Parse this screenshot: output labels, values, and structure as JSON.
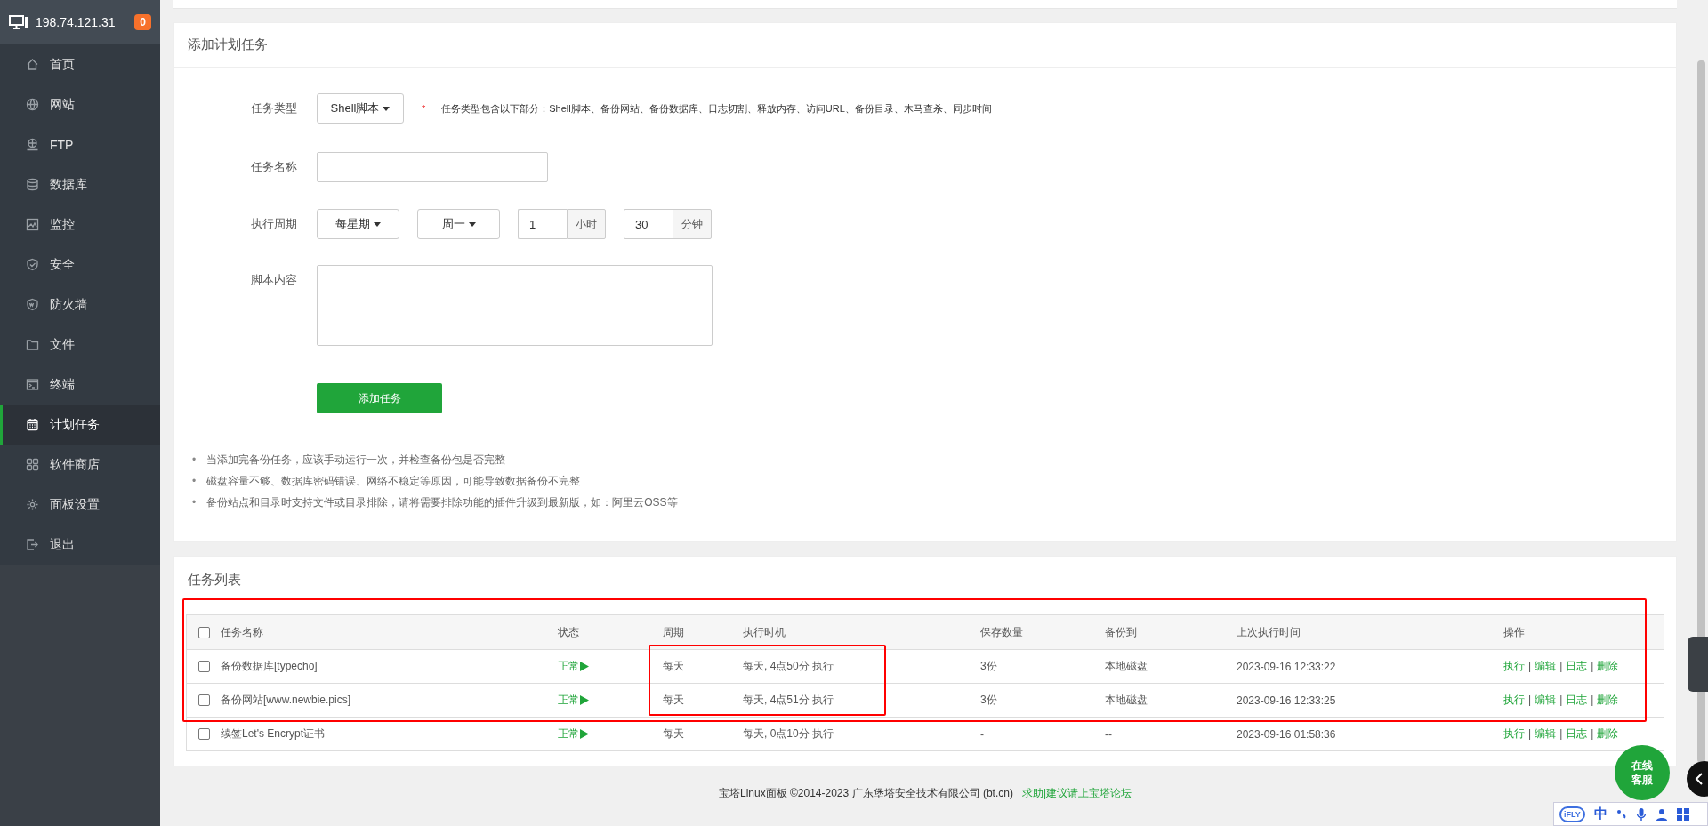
{
  "sidebar": {
    "host": "198.74.121.31",
    "badge": "0",
    "items": [
      {
        "label": "首页",
        "kind": "home",
        "selected": false
      },
      {
        "label": "网站",
        "kind": "globe",
        "selected": false
      },
      {
        "label": "FTP",
        "kind": "ftp",
        "selected": false
      },
      {
        "label": "数据库",
        "kind": "database",
        "selected": false
      },
      {
        "label": "监控",
        "kind": "monitor",
        "selected": false
      },
      {
        "label": "安全",
        "kind": "shield",
        "selected": false
      },
      {
        "label": "防火墙",
        "kind": "waf",
        "selected": false
      },
      {
        "label": "文件",
        "kind": "folder",
        "selected": false
      },
      {
        "label": "终端",
        "kind": "terminal",
        "selected": false
      },
      {
        "label": "计划任务",
        "kind": "calendar",
        "selected": true
      },
      {
        "label": "软件商店",
        "kind": "grid",
        "selected": false
      },
      {
        "label": "面板设置",
        "kind": "gear",
        "selected": false
      },
      {
        "label": "退出",
        "kind": "logout",
        "selected": false
      }
    ]
  },
  "form": {
    "title": "添加计划任务",
    "type_label": "任务类型",
    "type_select": "Shell脚本",
    "hint_mark": "*",
    "hint": "任务类型包含以下部分：Shell脚本、备份网站、备份数据库、日志切割、释放内存、访问URL、备份目录、木马查杀、同步时间",
    "name_label": "任务名称",
    "period_label": "执行周期",
    "period_select": "每星期",
    "weekday_select": "周一",
    "hour": "1",
    "hour_unit": "小时",
    "minute": "30",
    "minute_unit": "分钟",
    "script_label": "脚本内容",
    "submit": "添加任务"
  },
  "notes": [
    {
      "bullet": "•",
      "text": "当添加完备份任务，应该手动运行一次，并检查备份包是否完整"
    },
    {
      "bullet": "•",
      "text": "磁盘容量不够、数据库密码错误、网络不稳定等原因，可能导致数据备份不完整"
    },
    {
      "bullet": "•",
      "text": "备份站点和目录时支持文件或目录排除，请将需要排除功能的插件升级到最新版，如：阿里云OSS等"
    }
  ],
  "tasks": {
    "title": "任务列表",
    "checked_all": false,
    "action_separator": "|",
    "columns": [
      "任务名称",
      "状态",
      "周期",
      "执行时机",
      "保存数量",
      "备份到",
      "上次执行时间",
      "操作"
    ],
    "rows": [
      {
        "checked": false,
        "name": "备份数据库[typecho]",
        "status": "正常",
        "cycle": "每天",
        "time": "每天, 4点50分 执行",
        "keep": "3份",
        "backup_to": "本地磁盘",
        "last_run": "2023-09-16 12:33:22",
        "actions": [
          "执行",
          "编辑",
          "日志",
          "删除"
        ]
      },
      {
        "checked": false,
        "name": "备份网站[www.newbie.pics]",
        "status": "正常",
        "cycle": "每天",
        "time": "每天, 4点51分 执行",
        "keep": "3份",
        "backup_to": "本地磁盘",
        "last_run": "2023-09-16 12:33:25",
        "actions": [
          "执行",
          "编辑",
          "日志",
          "删除"
        ]
      },
      {
        "checked": false,
        "name": "续签Let's Encrypt证书",
        "status": "正常",
        "cycle": "每天",
        "time": "每天, 0点10分 执行",
        "keep": "-",
        "backup_to": "--",
        "last_run": "2023-09-16 01:58:36",
        "actions": [
          "执行",
          "编辑",
          "日志",
          "删除"
        ]
      }
    ]
  },
  "footer": {
    "text": "宝塔Linux面板 ©2014-2023 广东堡塔安全技术有限公司 (bt.cn)",
    "link": "求助|建议请上宝塔论坛"
  },
  "chat_button": [
    "在线",
    "客服"
  ],
  "ime_toolbar": {
    "logo": "iFLY",
    "lang": "中"
  }
}
